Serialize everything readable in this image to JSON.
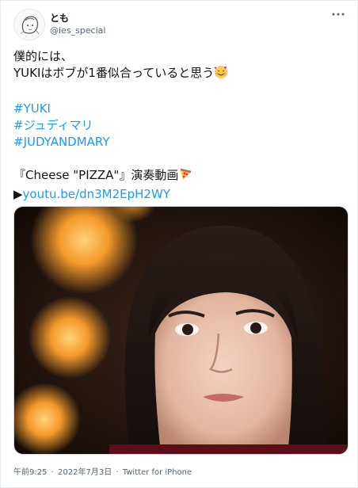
{
  "user": {
    "display_name": "とも",
    "handle": "@ies_special"
  },
  "tweet": {
    "line1": "僕的には、",
    "line2": "YUKIはボブが1番似合っていると思う",
    "hashtags": [
      "#YUKI",
      "#ジュディマリ",
      "#JUDYANDMARY"
    ],
    "video_title": "『Cheese \"PIZZA\"』演奏動画",
    "link_prefix": "▶",
    "link": "youtu.be/dn3M2EpH2WY"
  },
  "meta": {
    "time": "午前9:25",
    "date": "2022年7月3日",
    "separator": "·",
    "source": "Twitter for iPhone"
  },
  "icons": [
    "avatar",
    "more-icon",
    "smiling-face-with-hearts-emoji",
    "pizza-emoji"
  ],
  "colors": {
    "link": "#1d9bf0",
    "text": "#0f1419",
    "secondary": "#536471"
  }
}
